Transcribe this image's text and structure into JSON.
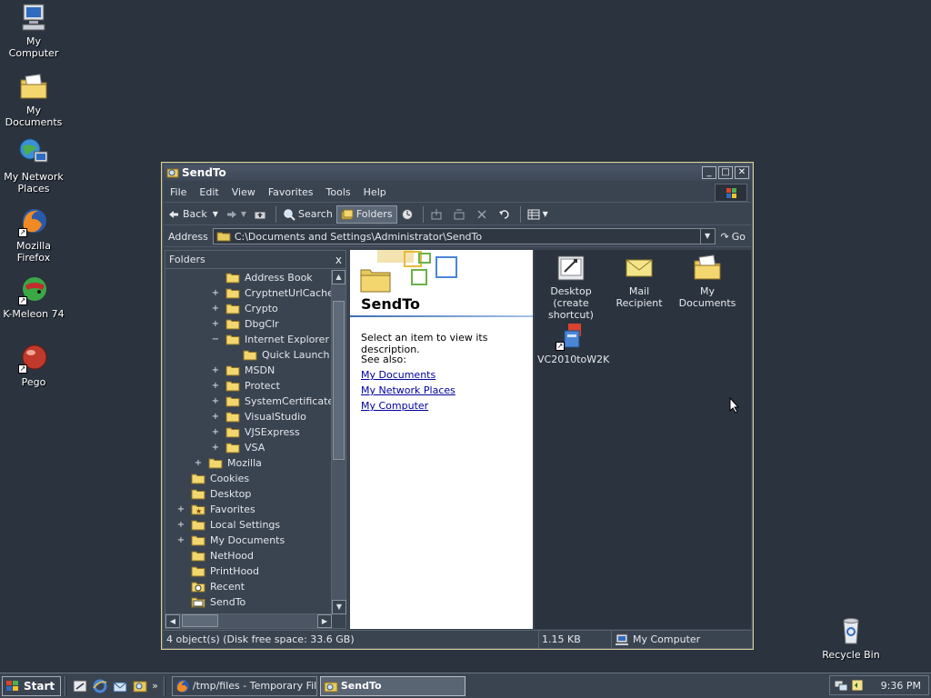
{
  "desktop": {
    "icons": [
      {
        "label": "My Computer"
      },
      {
        "label": "My Documents"
      },
      {
        "label": "My Network Places"
      },
      {
        "label": "Mozilla Firefox"
      },
      {
        "label": "K-Meleon 74"
      },
      {
        "label": "Pego"
      },
      {
        "label": "Recycle Bin"
      }
    ]
  },
  "window": {
    "title": "SendTo",
    "menu": [
      "File",
      "Edit",
      "View",
      "Favorites",
      "Tools",
      "Help"
    ],
    "toolbar": {
      "back": "Back",
      "search": "Search",
      "folders": "Folders"
    },
    "address": {
      "label": "Address",
      "value": "C:\\Documents and Settings\\Administrator\\SendTo",
      "go": "Go"
    },
    "folders_pane": {
      "header": "Folders",
      "close": "x",
      "tree": [
        {
          "label": "Address Book",
          "exp": ""
        },
        {
          "label": "CryptnetUrlCache",
          "exp": "+"
        },
        {
          "label": "Crypto",
          "exp": "+"
        },
        {
          "label": "DbgClr",
          "exp": "+"
        },
        {
          "label": "Internet Explorer",
          "exp": "−"
        },
        {
          "label": "Quick Launch",
          "exp": ""
        },
        {
          "label": "MSDN",
          "exp": "+"
        },
        {
          "label": "Protect",
          "exp": "+"
        },
        {
          "label": "SystemCertificates",
          "exp": "+"
        },
        {
          "label": "VisualStudio",
          "exp": "+"
        },
        {
          "label": "VJSExpress",
          "exp": "+"
        },
        {
          "label": "VSA",
          "exp": "+"
        },
        {
          "label": "Mozilla",
          "exp": "+"
        },
        {
          "label": "Cookies",
          "exp": ""
        },
        {
          "label": "Desktop",
          "exp": ""
        },
        {
          "label": "Favorites",
          "exp": "+"
        },
        {
          "label": "Local Settings",
          "exp": "+"
        },
        {
          "label": "My Documents",
          "exp": "+"
        },
        {
          "label": "NetHood",
          "exp": ""
        },
        {
          "label": "PrintHood",
          "exp": ""
        },
        {
          "label": "Recent",
          "exp": ""
        },
        {
          "label": "SendTo",
          "exp": ""
        }
      ]
    },
    "info_panel": {
      "title": "SendTo",
      "description": "Select an item to view its description.",
      "see_also": "See also:",
      "links": [
        "My Documents",
        "My Network Places",
        "My Computer"
      ]
    },
    "files": [
      {
        "label": "Desktop (create shortcut)"
      },
      {
        "label": "Mail Recipient"
      },
      {
        "label": "My Documents"
      },
      {
        "label": "VC2010toW2K"
      }
    ],
    "status": {
      "objects": "4 object(s) (Disk free space: 33.6 GB)",
      "size": "1.15 KB",
      "zone": "My Computer"
    }
  },
  "taskbar": {
    "start": "Start",
    "tasks": [
      {
        "label": "/tmp/files - Temporary Fil..."
      },
      {
        "label": "SendTo"
      }
    ],
    "clock": "9:36 PM"
  }
}
